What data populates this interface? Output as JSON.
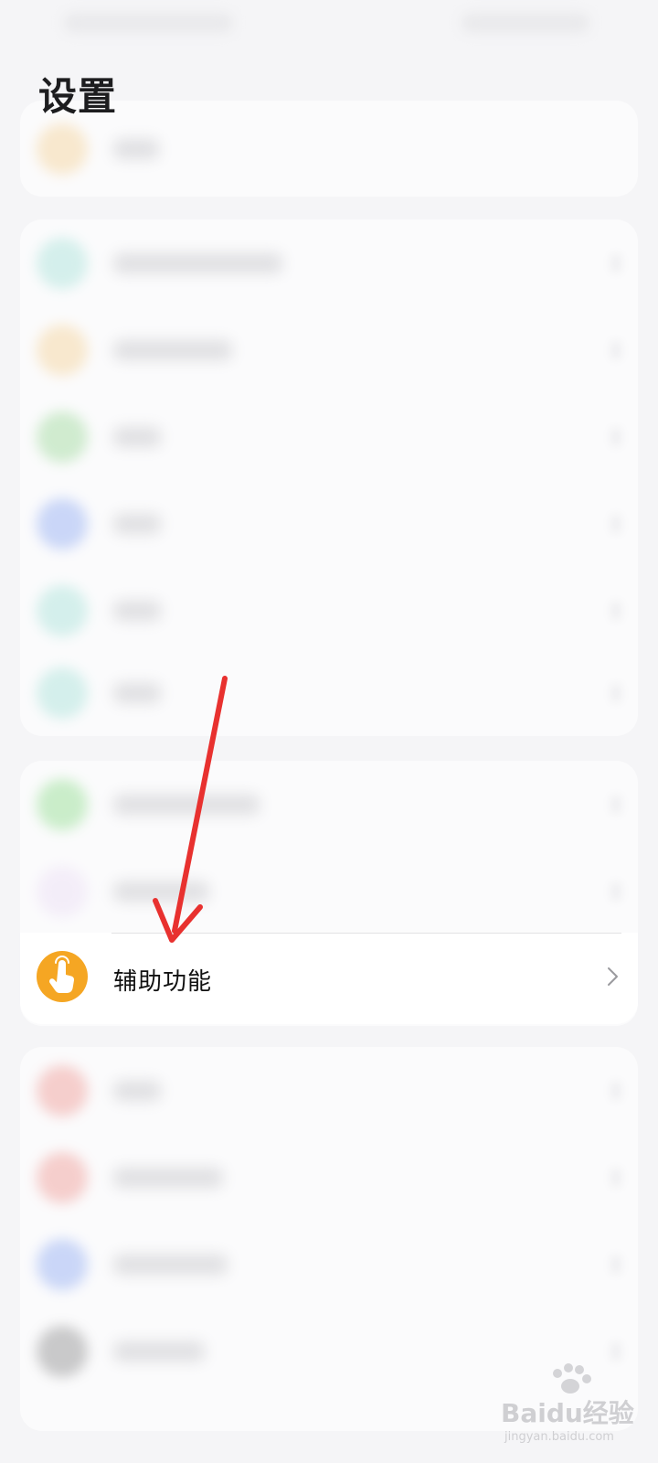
{
  "header": {
    "title": "设置"
  },
  "focused_item": {
    "label": "辅助功能",
    "icon": "hand-tap-icon",
    "icon_color": "#f5a623"
  },
  "annotation": {
    "arrow_color": "#e8312f"
  },
  "watermark": {
    "text": "Baidu经验",
    "sub": "jingyan.baidu.com"
  },
  "blurred_icon_colors": {
    "orange": "#f6c777",
    "teal": "#8ddccf",
    "green": "#7fd07a",
    "blue": "#6f93f2",
    "lightgreen": "#6ed66a",
    "pastel": "#e9d7f5",
    "red": "#ee7a72",
    "darkgray": "#6b6b6b"
  }
}
